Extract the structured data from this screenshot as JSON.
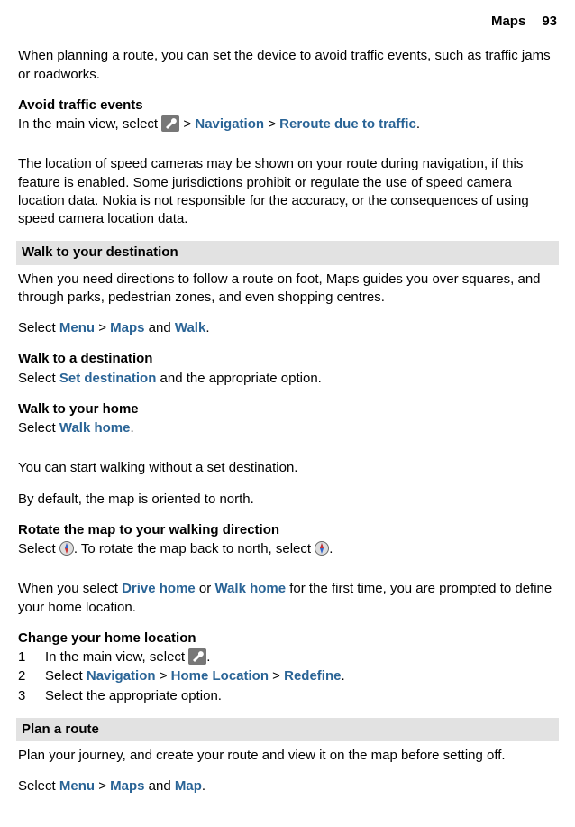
{
  "header": {
    "section": "Maps",
    "page": "93"
  },
  "intro": "When planning a route, you can set the device to avoid traffic events, such as traffic jams or roadworks.",
  "avoid": {
    "heading": "Avoid traffic events",
    "prefix": "In the main view, select ",
    "gt1": " > ",
    "nav": "Navigation",
    "gt2": " > ",
    "reroute": "Reroute due to traffic",
    "dot": "."
  },
  "speedcam": "The location of speed cameras may be shown on your route during navigation, if this feature is enabled. Some jurisdictions prohibit or regulate the use of speed camera location data. Nokia is not responsible for the accuracy, or the consequences of using speed camera location data.",
  "walk": {
    "bar": "Walk to your destination",
    "intro": "When you need directions to follow a route on foot, Maps guides you over squares, and through parks, pedestrian zones, and even shopping centres.",
    "sel_prefix": "Select ",
    "menu": "Menu",
    "gt": " > ",
    "maps": "Maps",
    "and": " and ",
    "walk": "Walk",
    "dot": ".",
    "dest_h": "Walk to a destination",
    "dest_prefix": "Select ",
    "dest_ref": "Set destination",
    "dest_suffix": " and the appropriate option.",
    "home_h": "Walk to your home",
    "home_prefix": "Select ",
    "home_ref": "Walk home",
    "home_dot": "."
  },
  "walk2": {
    "p1": "You can start walking without a set destination.",
    "p2": "By default, the map is oriented to north."
  },
  "rotate": {
    "h": "Rotate the map to your walking direction",
    "prefix": "Select ",
    "mid": ". To rotate the map back to north, select ",
    "dot": "."
  },
  "drivehome": {
    "prefix": "When you select ",
    "dh": "Drive home",
    "or": " or ",
    "wh": "Walk home",
    "suffix": " for the first time, you are prompted to define your home location."
  },
  "change": {
    "h": "Change your home location",
    "s1_prefix": "In the main view, select ",
    "s1_dot": ".",
    "s2_prefix": "Select ",
    "s2_nav": "Navigation",
    "s2_gt1": " > ",
    "s2_home": "Home Location",
    "s2_gt2": " > ",
    "s2_redef": "Redefine",
    "s2_dot": ".",
    "s3": "Select the appropriate option.",
    "n1": "1",
    "n2": "2",
    "n3": "3"
  },
  "plan": {
    "bar": "Plan a route",
    "intro": "Plan your journey, and create your route and view it on the map before setting off.",
    "sel_prefix": "Select ",
    "menu": "Menu",
    "gt": " > ",
    "maps": "Maps",
    "and": " and ",
    "map": "Map",
    "dot": "."
  }
}
